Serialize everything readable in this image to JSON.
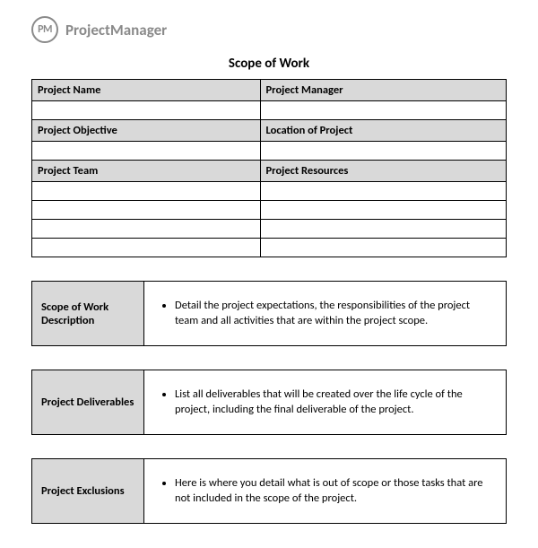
{
  "logo": {
    "initials": "PM",
    "brand": "ProjectManager"
  },
  "title": "Scope of Work",
  "grid": {
    "row1": {
      "left": "Project Name",
      "right": "Project Manager"
    },
    "row2": {
      "left": "Project Objective",
      "right": "Location of Project"
    },
    "row3": {
      "left": "Project Team",
      "right": "Project Resources"
    }
  },
  "sections": {
    "desc": {
      "label": "Scope of Work Description",
      "text": "Detail the project expectations, the responsibilities of the project team and all activities that are within the project scope."
    },
    "deliverables": {
      "label": "Project Deliverables",
      "text": "List all deliverables that will be created over the life cycle of the project, including the final deliverable of the project."
    },
    "exclusions": {
      "label": "Project Exclusions",
      "text": "Here is where you detail what is out of scope or those tasks that are not included in the scope of the project."
    }
  }
}
